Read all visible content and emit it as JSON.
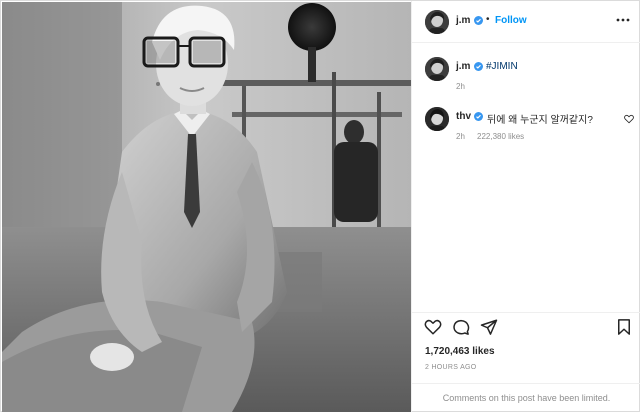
{
  "header": {
    "username": "j.m",
    "separator": "•",
    "follow_label": "Follow"
  },
  "caption": {
    "username": "j.m",
    "text": "#JIMIN",
    "time": "2h"
  },
  "comments": [
    {
      "username": "thv",
      "text": "뒤에 왜 누군지 알꺼같지?",
      "time": "2h",
      "likes": "222,380 likes"
    }
  ],
  "post": {
    "likes_count": "1,720,463 likes",
    "posted": "2 HOURS AGO",
    "comments_notice": "Comments on this post have been limited."
  },
  "icons": {
    "like": "heart-icon",
    "comment": "comment-icon",
    "share": "share-icon",
    "save": "bookmark-icon",
    "verified": "verified-badge-icon",
    "more": "more-options-icon",
    "comment_like": "heart-icon"
  },
  "colors": {
    "accent": "#0095f6",
    "verified": "#3897f0",
    "text": "#262626",
    "secondary": "#8e8e8e",
    "border": "#efefef"
  }
}
